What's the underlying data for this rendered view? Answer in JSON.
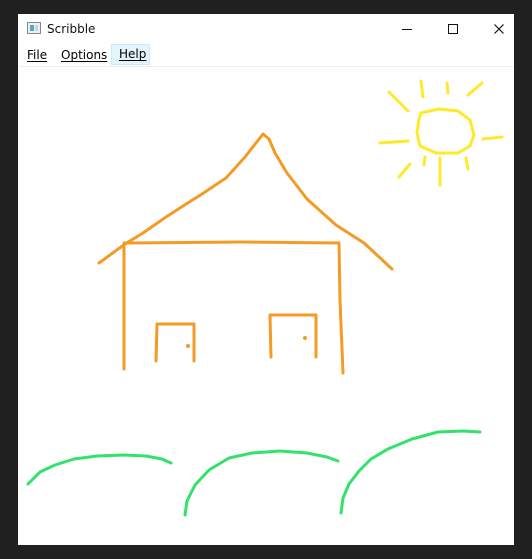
{
  "window": {
    "title": "Scribble",
    "app_icon": "scribble-app-icon",
    "controls": {
      "minimize_icon": "minimize-icon",
      "maximize_icon": "maximize-icon",
      "close_icon": "close-icon"
    }
  },
  "menu": {
    "items": [
      {
        "label": "File"
      },
      {
        "label": "Options"
      },
      {
        "label": "Help"
      }
    ]
  },
  "drawing": {
    "pen_colors": {
      "house": "#f39b26",
      "sun": "#ffe92a",
      "grass": "#33e26c"
    }
  }
}
